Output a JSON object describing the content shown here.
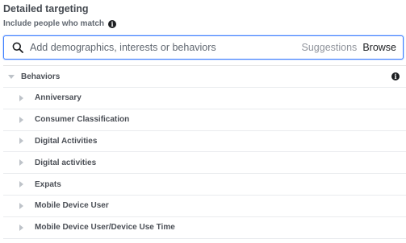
{
  "header": {
    "title": "Detailed targeting",
    "subtitle": "Include people who match"
  },
  "search": {
    "placeholder": "Add demographics, interests or behaviors",
    "suggestions_label": "Suggestions",
    "browse_label": "Browse"
  },
  "tree": {
    "category": "Behaviors",
    "items": [
      {
        "label": "Anniversary"
      },
      {
        "label": "Consumer Classification"
      },
      {
        "label": "Digital Activities"
      },
      {
        "label": "Digital activities"
      },
      {
        "label": "Expats"
      },
      {
        "label": "Mobile Device User"
      },
      {
        "label": "Mobile Device User/Device Use Time"
      }
    ]
  },
  "icons": {
    "info": "info-icon",
    "search": "search-icon",
    "expand": "caret-right-icon",
    "collapse": "caret-down-icon"
  },
  "colors": {
    "accent": "#4080ff",
    "text": "#1c1e21",
    "muted": "#606770",
    "divider": "#e9ebee"
  }
}
